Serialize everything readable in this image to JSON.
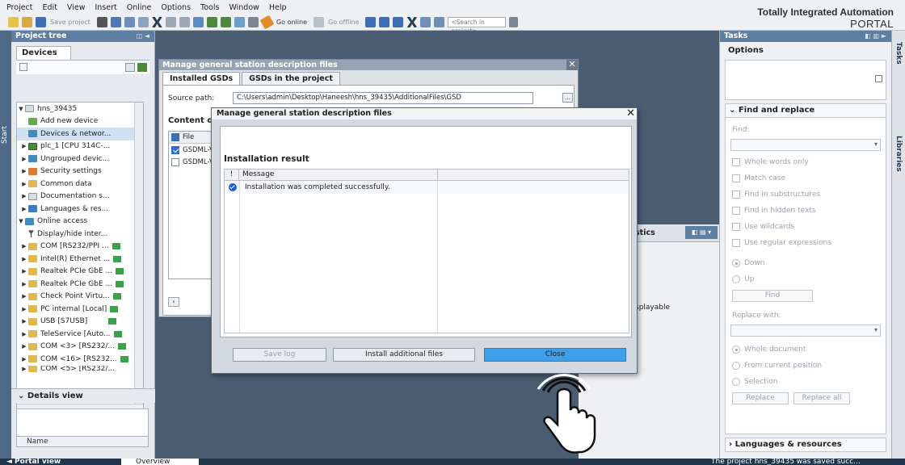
{
  "menu": [
    "Project",
    "Edit",
    "View",
    "Insert",
    "Online",
    "Options",
    "Tools",
    "Window",
    "Help"
  ],
  "toolbar": {
    "save_project": "Save project",
    "go_online": "Go online",
    "go_offline": "Go offline",
    "search_placeholder": "<Search in project>"
  },
  "brand": {
    "title": "Totally Integrated Automation",
    "subtitle": "PORTAL"
  },
  "start_label": "Start",
  "project_tree": {
    "header": "Project tree",
    "devices_tab": "Devices",
    "items": [
      {
        "label": "hns_39435"
      },
      {
        "label": "Add new device"
      },
      {
        "label": "Devices & networ..."
      },
      {
        "label": "plc_1 [CPU 314C-..."
      },
      {
        "label": "Ungrouped devic..."
      },
      {
        "label": "Security settings"
      },
      {
        "label": "Common data"
      },
      {
        "label": "Documentation s..."
      },
      {
        "label": "Languages & res..."
      },
      {
        "label": "Online access"
      },
      {
        "label": "Display/hide inter..."
      },
      {
        "label": "COM [RS232/PPI ..."
      },
      {
        "label": "Intel(R) Ethernet ..."
      },
      {
        "label": "Realtek PCIe GbE ..."
      },
      {
        "label": "Realtek PCIe GbE ..."
      },
      {
        "label": "Check Point Virtu..."
      },
      {
        "label": "PC internal [Local]"
      },
      {
        "label": "USB [S7USB]"
      },
      {
        "label": "TeleService [Auto..."
      },
      {
        "label": "COM <3> [RS232/..."
      },
      {
        "label": "COM <16> [RS232..."
      },
      {
        "label": "COM <5> [RS232/..."
      }
    ],
    "details_view": "Details view",
    "name_col": "Name"
  },
  "gsd_dialog": {
    "title": "Manage general station description files",
    "tabs": [
      "Installed GSDs",
      "GSDs in the project"
    ],
    "source_label": "Source path:",
    "source_path": "C:\\Users\\admin\\Desktop\\Haneesh\\hns_39435\\AdditionalFiles\\GSD",
    "browse": "...",
    "content_of": "Content of",
    "file_col": "File",
    "files": [
      "GSDML-V",
      "GSDML-V"
    ]
  },
  "result_dialog": {
    "title": "Manage general station description files",
    "section": "Installation result",
    "col_flag": "!",
    "col_message": "Message",
    "message": "Installation was completed successfully.",
    "save_log": "Save log",
    "install_more": "Install additional files",
    "close": "Close"
  },
  "inspector": {
    "diag_tab": "stics",
    "displayable": "splayable"
  },
  "tasks": {
    "header": "Tasks",
    "options": "Options",
    "find_replace": "Find and replace",
    "find_label": "Find:",
    "checks": [
      "Whole words only",
      "Match case",
      "Find in substructures",
      "Find in hidden texts",
      "Use wildcards",
      "Use regular expressions"
    ],
    "down": "Down",
    "up": "Up",
    "find_btn": "Find",
    "replace_with": "Replace with:",
    "scope": [
      "Whole document",
      "From current position",
      "Selection"
    ],
    "replace_btn": "Replace",
    "replace_all_btn": "Replace all",
    "languages": "Languages & resources"
  },
  "side_tabs": [
    "Tasks",
    "Libraries"
  ],
  "status": {
    "portal_view": "◄  Portal view",
    "overview": "Overview",
    "message": "The project hns_39435 was saved succ..."
  }
}
